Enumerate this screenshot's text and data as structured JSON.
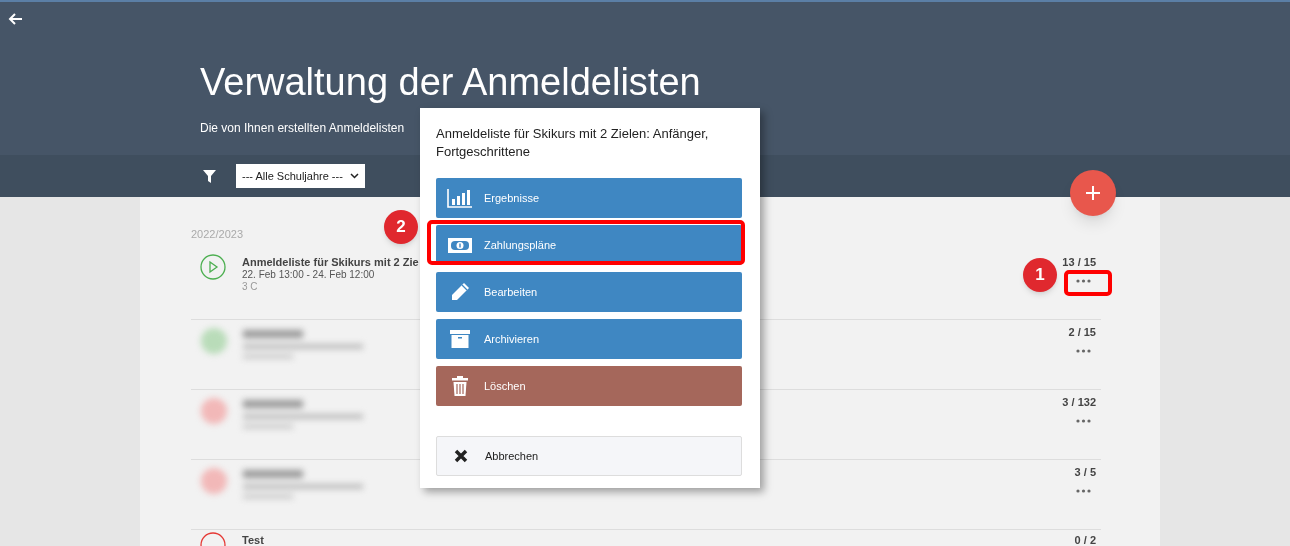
{
  "header": {
    "title": "Verwaltung der Anmeldelisten",
    "subtitle": "Die von Ihnen erstellten Anmeldelisten"
  },
  "filter": {
    "value": "--- Alle Schuljahre ---"
  },
  "group": "2022/2023",
  "rows": [
    {
      "kind": "clear",
      "color": "#4caf50",
      "title": "Anmeldeliste für Skikurs mit 2 Zie",
      "dates": "22. Feb 13:00 - 24. Feb 12:00",
      "class": "3 C",
      "count": "13 / 15"
    },
    {
      "kind": "blurred",
      "color": "#b9dcb9",
      "count": "2 / 15"
    },
    {
      "kind": "blurred",
      "color": "#f2b8b8",
      "count": "3 / 132"
    },
    {
      "kind": "blurred",
      "color": "#f2b8b8",
      "count": "3 / 5"
    },
    {
      "kind": "cut",
      "color": "#e53935",
      "title": "Test",
      "count": "0 / 2"
    }
  ],
  "menu": {
    "title": "Anmeldeliste für Skikurs mit 2 Zielen: Anfänger, Fortgeschrittene",
    "items": [
      {
        "kind": "results",
        "label": "Ergebnisse"
      },
      {
        "kind": "payments",
        "label": "Zahlungspläne"
      },
      {
        "kind": "edit",
        "label": "Bearbeiten"
      },
      {
        "kind": "archive",
        "label": "Archivieren"
      },
      {
        "kind": "delete",
        "label": "Löschen"
      },
      {
        "kind": "cancel",
        "label": "Abbrechen"
      }
    ]
  },
  "annotations": [
    {
      "label": "1"
    },
    {
      "label": "2"
    }
  ]
}
